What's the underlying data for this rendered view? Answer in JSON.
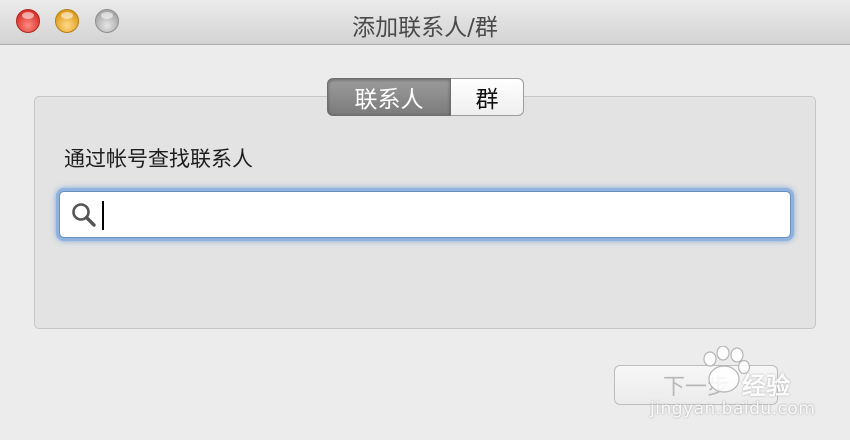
{
  "window": {
    "title": "添加联系人/群"
  },
  "tabs": [
    {
      "label": "联系人",
      "selected": true
    },
    {
      "label": "群",
      "selected": false
    }
  ],
  "main": {
    "prompt": "通过帐号查找联系人",
    "search": {
      "value": "",
      "placeholder": "",
      "icon": "search-icon"
    },
    "next_button": {
      "label": "下一步",
      "enabled": false
    }
  },
  "watermark": {
    "brand": "经验",
    "url": "jingyan.baidu.com"
  },
  "colors": {
    "accent_focus": "#8fb2df",
    "segment_selected": "#8a8a8a",
    "close": "#d9332b",
    "minimize": "#e09e1c",
    "zoom": "#a8a8a8"
  }
}
